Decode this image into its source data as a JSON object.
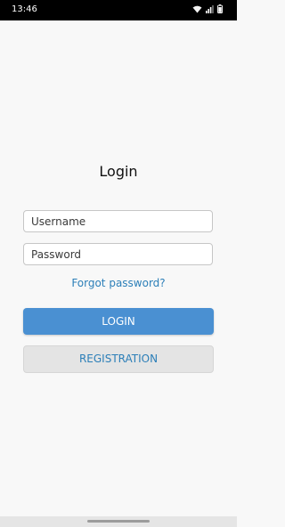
{
  "status_bar": {
    "time": "13:46",
    "icons": [
      "wifi-icon",
      "signal-icon",
      "battery-icon"
    ]
  },
  "login": {
    "title": "Login",
    "username_placeholder": "Username",
    "password_placeholder": "Password",
    "forgot_password": "Forgot password?",
    "login_button": "LOGIN",
    "registration_button": "REGISTRATION"
  },
  "colors": {
    "accent": "#4a90d2",
    "link": "#2c7fb8",
    "status_bar_bg": "#000000",
    "background": "#f8f8f8"
  }
}
